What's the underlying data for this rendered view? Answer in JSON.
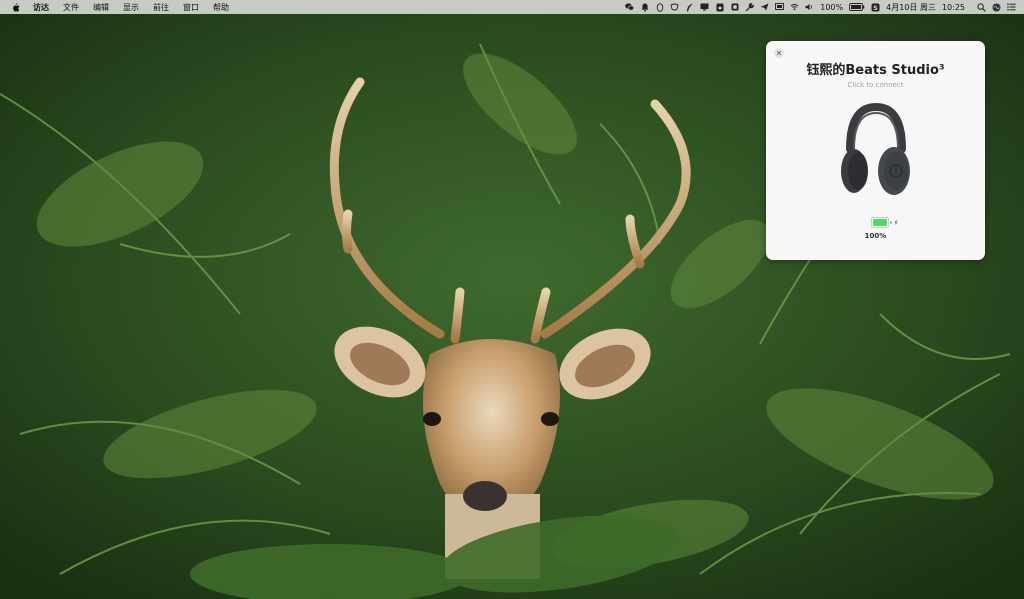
{
  "menubar": {
    "items": [
      "访达",
      "文件",
      "编辑",
      "显示",
      "前往",
      "窗口",
      "帮助"
    ],
    "battery_percent": "100%",
    "date": "4月10日 周三",
    "time": "10:25",
    "status_icons": [
      "wechat-icon",
      "bell-icon",
      "qq-penguin-icon",
      "mask-icon",
      "feather-icon",
      "monitor-icon",
      "music-icon",
      "app-box-icon",
      "wrench-icon",
      "send-icon",
      "display-icon",
      "wifi-icon",
      "volume-icon",
      "battery-icon",
      "app-s-icon",
      "search-icon",
      "siri-icon",
      "notification-list-icon"
    ]
  },
  "notification": {
    "title": "钰熙的Beats Studio³",
    "subtitle": "Click to connect",
    "battery_label": "100%",
    "battery_level": 1.0,
    "battery_color": "#4cd964",
    "device_icon": "beats-studio3-headphones"
  },
  "desktop": {
    "wallpaper": "deer-in-ferns"
  }
}
